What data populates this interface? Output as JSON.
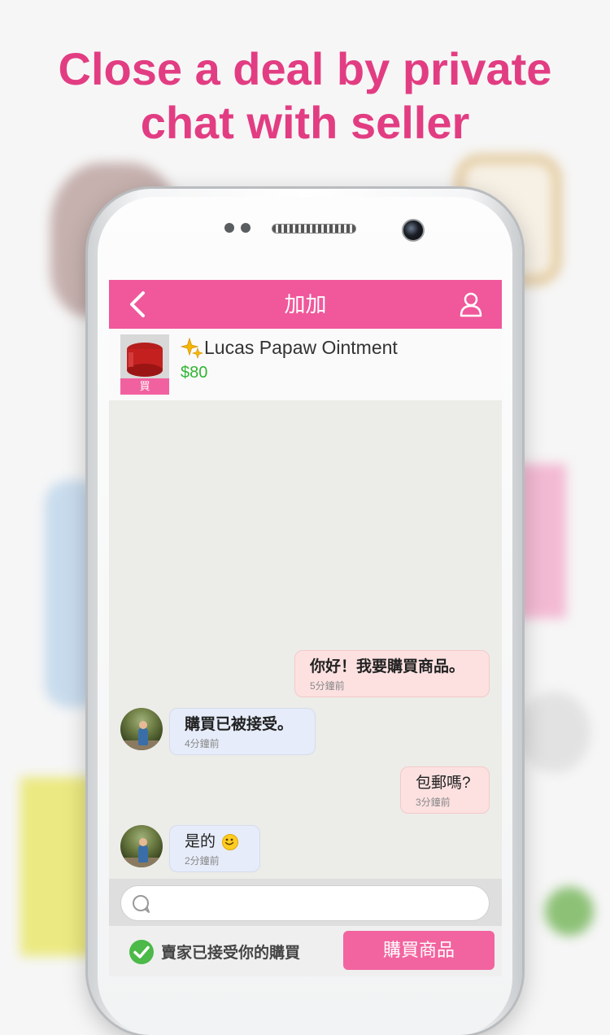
{
  "headline": "Close a deal by private\nchat with seller",
  "nav": {
    "title": "加加",
    "back_icon": "chevron-left-icon",
    "profile_icon": "user-icon"
  },
  "product": {
    "tag": "買",
    "name": "Lucas Papaw Ointment",
    "price": "$80",
    "sparkle_icon": "sparkle-icon"
  },
  "messages": [
    {
      "side": "out",
      "text": "你好！我要購買商品。",
      "time": "5分鐘前"
    },
    {
      "side": "in",
      "text": "購買已被接受。",
      "time": "4分鐘前"
    },
    {
      "side": "out",
      "text": "包郵嗎?",
      "time": "3分鐘前"
    },
    {
      "side": "in",
      "text": "是的",
      "emoji": "smile-emoji",
      "time": "2分鐘前"
    }
  ],
  "input": {
    "placeholder": "",
    "icon": "chat-bubble-icon"
  },
  "footer": {
    "status": "賣家已接受你的購買",
    "status_icon": "check-circle-icon",
    "buy_label": "購買商品"
  },
  "colors": {
    "brand_pink": "#f0589b",
    "headline": "#e23d82",
    "price_green": "#31b431",
    "outgoing_bubble": "#fde1e1",
    "incoming_bubble": "#e6ecf9"
  }
}
